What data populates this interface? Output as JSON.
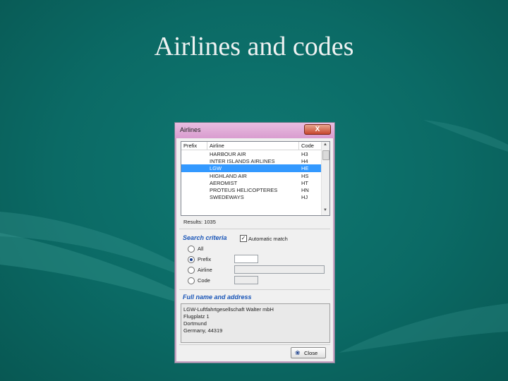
{
  "slide": {
    "title": "Airlines and codes"
  },
  "dialog": {
    "title": "Airlines",
    "close_glyph": "X",
    "columns": [
      "Prefix",
      "Airline",
      "Code"
    ],
    "rows": [
      {
        "prefix": "",
        "airline": "HARBOUR AIR",
        "code": "H3",
        "selected": false
      },
      {
        "prefix": "",
        "airline": "INTER ISLANDS AIRLINES",
        "code": "H4",
        "selected": false
      },
      {
        "prefix": "",
        "airline": "LGW",
        "code": "HE",
        "selected": true
      },
      {
        "prefix": "",
        "airline": "HIGHLAND AIR",
        "code": "HS",
        "selected": false
      },
      {
        "prefix": "",
        "airline": "AEROMIST",
        "code": "HT",
        "selected": false
      },
      {
        "prefix": "",
        "airline": "PROTEUS HELICOPTERES",
        "code": "HN",
        "selected": false
      },
      {
        "prefix": "",
        "airline": "SWEDEWAYS",
        "code": "HJ",
        "selected": false
      }
    ],
    "results": "Results: 1035",
    "search": {
      "title": "Search criteria",
      "auto_label": "Automatic match",
      "auto_checked": true,
      "options": [
        {
          "label": "All",
          "checked": false
        },
        {
          "label": "Prefix",
          "checked": true
        },
        {
          "label": "Airline",
          "checked": false
        },
        {
          "label": "Code",
          "checked": false
        }
      ]
    },
    "address": {
      "title": "Full name and address",
      "lines": [
        "LGW-Luftfahrtgesellschaft Walter mbH",
        "Flugplatz 1",
        "Dortmund",
        "Germany, 44319"
      ]
    },
    "close_button": "Close"
  }
}
